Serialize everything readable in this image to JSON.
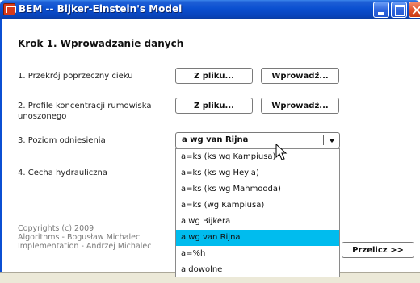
{
  "window": {
    "title": "BEM -- Bijker-Einstein's Model",
    "controls": {
      "minimize": "minimize",
      "maximize": "maximize",
      "close": "close"
    }
  },
  "step_title": "Krok 1. Wprowadzanie danych",
  "rows": {
    "cross_section": {
      "label": "1. Przekrój poprzeczny cieku",
      "file_button": "Z pliku...",
      "input_button": "Wprowadź..."
    },
    "profiles": {
      "label_line1": "2. Profile koncentracji rumowiska",
      "label_line2": "unoszonego",
      "file_button": "Z pliku...",
      "input_button": "Wprowadź..."
    },
    "reference_level": {
      "label": "3. Poziom odniesienia",
      "selected": "a wg van Rijna"
    },
    "hydraulic": {
      "label": "4. Cecha hydrauliczna"
    }
  },
  "dropdown": {
    "options": [
      "a=ks (ks wg Kampiusa)",
      "a=ks (ks wg Hey'a)",
      "a=ks (ks wg Mahmooda)",
      "a=ks (wg Kampiusa)",
      "a wg Bijkera",
      "a wg van Rijna",
      "a=%h",
      "a dowolne"
    ],
    "selected_index": 5,
    "highlight_color": "#00bcee"
  },
  "copyright": {
    "line1": "Copyrights (c) 2009",
    "line2": "Algorithms - Bogusław Michalec",
    "line3": "Implementation - Andrzej Michalec"
  },
  "calculate_button": "Przelicz >>",
  "colors": {
    "titlebar": "#0a4fd0",
    "close": "#e0502a"
  }
}
